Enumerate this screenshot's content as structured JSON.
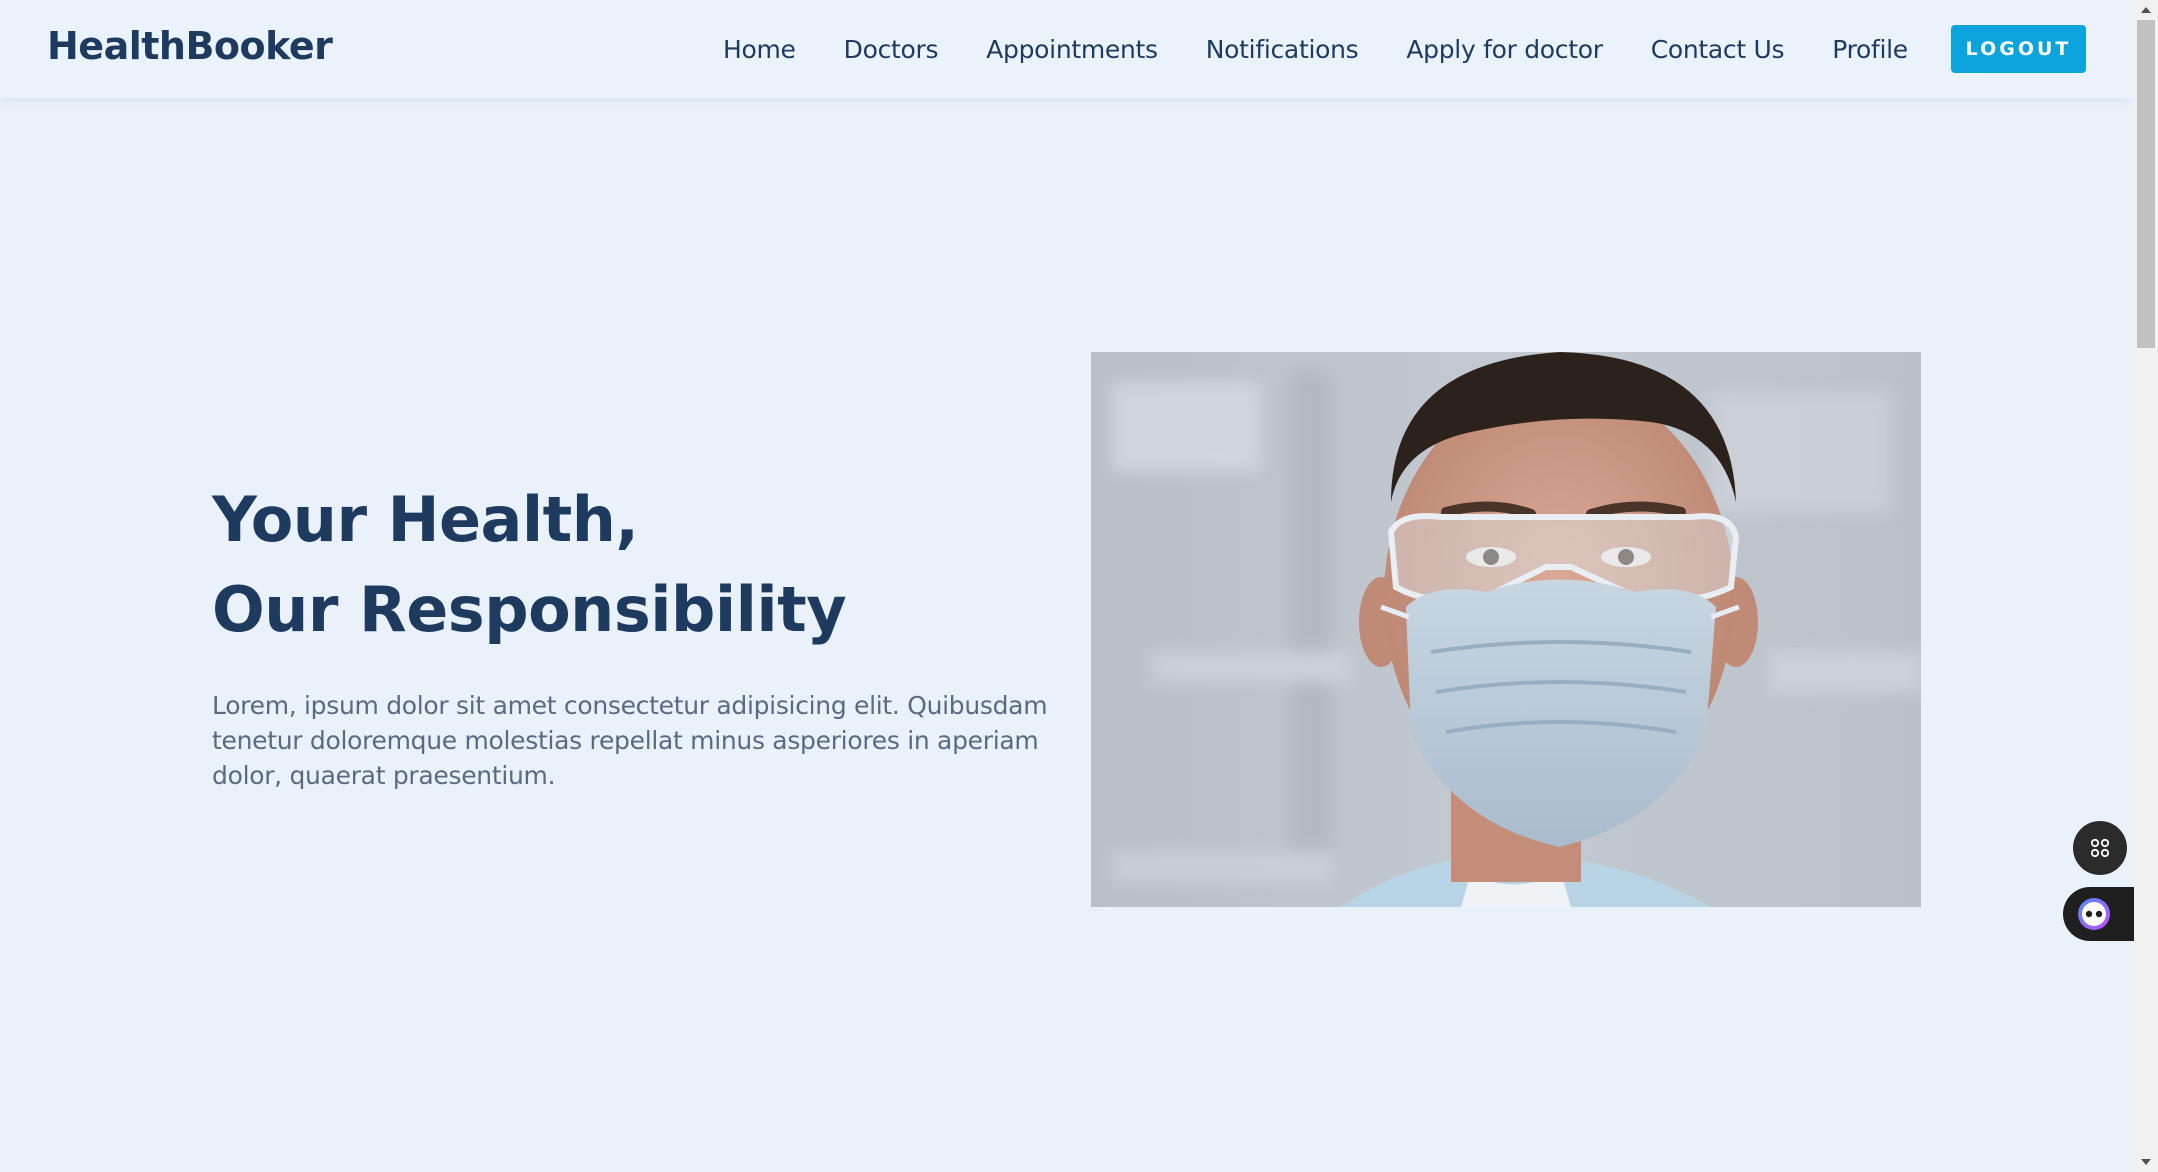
{
  "navbar": {
    "brand": "HealthBooker",
    "links": [
      {
        "label": "Home"
      },
      {
        "label": "Doctors"
      },
      {
        "label": "Appointments"
      },
      {
        "label": "Notifications"
      },
      {
        "label": "Apply for doctor"
      },
      {
        "label": "Contact Us"
      },
      {
        "label": "Profile"
      }
    ],
    "logout_label": "LOGOUT"
  },
  "hero": {
    "title_line1": "Your Health,",
    "title_line2": "Our Responsibility",
    "text": "Lorem, ipsum dolor sit amet consectetur adipisicing elit. Quibusdam tenetur doloremque molestias repellat minus asperiores in aperiam dolor, quaerat praesentium.",
    "image_subject": "doctor-wearing-mask-and-safety-glasses"
  },
  "floating": {
    "grid_icon": "command-grid-icon",
    "bot_icon": "assistant-bot-icon"
  },
  "colors": {
    "background": "#e9f1fb",
    "brand_text": "#1e3a5f",
    "body_text": "#5b6a80",
    "accent": "#0aa3dc"
  }
}
